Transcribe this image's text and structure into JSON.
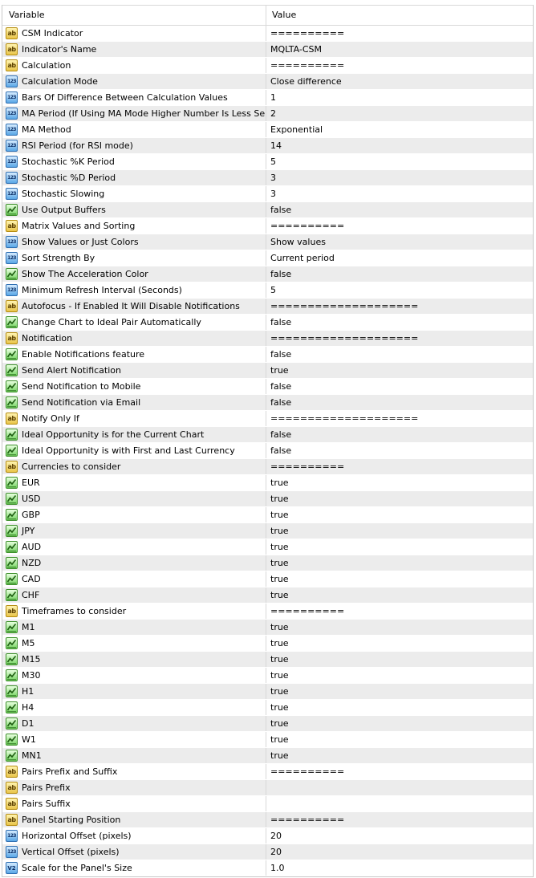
{
  "header": {
    "variable": "Variable",
    "value": "Value"
  },
  "icon_glyphs": {
    "ab": "ab",
    "num": "123",
    "dbl": "V2"
  },
  "rows": [
    {
      "icon": "ab",
      "name": "CSM Indicator",
      "value": "=========="
    },
    {
      "icon": "ab",
      "name": "Indicator's Name",
      "value": "MQLTA-CSM"
    },
    {
      "icon": "ab",
      "name": "Calculation",
      "value": "=========="
    },
    {
      "icon": "num",
      "name": "Calculation Mode",
      "value": "Close difference"
    },
    {
      "icon": "num",
      "name": "Bars Of Difference Between Calculation Values",
      "value": "1"
    },
    {
      "icon": "num",
      "name": "MA Period (If Using MA Mode Higher Number Is Less Sensitive)",
      "value": "2"
    },
    {
      "icon": "num",
      "name": "MA Method",
      "value": "Exponential"
    },
    {
      "icon": "num",
      "name": "RSI Period (for RSI mode)",
      "value": "14"
    },
    {
      "icon": "num",
      "name": "Stochastic %K Period",
      "value": "5"
    },
    {
      "icon": "num",
      "name": "Stochastic %D Period",
      "value": "3"
    },
    {
      "icon": "num",
      "name": "Stochastic Slowing",
      "value": "3"
    },
    {
      "icon": "bool",
      "name": "Use Output Buffers",
      "value": "false"
    },
    {
      "icon": "ab",
      "name": "Matrix Values and Sorting",
      "value": "=========="
    },
    {
      "icon": "num",
      "name": "Show Values or Just Colors",
      "value": "Show values"
    },
    {
      "icon": "num",
      "name": "Sort Strength By",
      "value": "Current period"
    },
    {
      "icon": "bool",
      "name": "Show The Acceleration Color",
      "value": "false"
    },
    {
      "icon": "num",
      "name": "Minimum Refresh Interval (Seconds)",
      "value": "5"
    },
    {
      "icon": "ab",
      "name": "Autofocus - If Enabled It Will Disable Notifications",
      "value": "===================="
    },
    {
      "icon": "bool",
      "name": "Change Chart to Ideal Pair Automatically",
      "value": "false"
    },
    {
      "icon": "ab",
      "name": "Notification",
      "value": "===================="
    },
    {
      "icon": "bool",
      "name": "Enable Notifications feature",
      "value": "false"
    },
    {
      "icon": "bool",
      "name": "Send Alert Notification",
      "value": "true"
    },
    {
      "icon": "bool",
      "name": "Send Notification to Mobile",
      "value": "false"
    },
    {
      "icon": "bool",
      "name": "Send Notification via Email",
      "value": "false"
    },
    {
      "icon": "ab",
      "name": "Notify Only If",
      "value": "===================="
    },
    {
      "icon": "bool",
      "name": "Ideal Opportunity is for the Current Chart",
      "value": "false"
    },
    {
      "icon": "bool",
      "name": "Ideal Opportunity is with First and Last Currency",
      "value": "false"
    },
    {
      "icon": "ab",
      "name": "Currencies to consider",
      "value": "=========="
    },
    {
      "icon": "bool",
      "name": "EUR",
      "value": "true"
    },
    {
      "icon": "bool",
      "name": "USD",
      "value": "true"
    },
    {
      "icon": "bool",
      "name": "GBP",
      "value": "true"
    },
    {
      "icon": "bool",
      "name": "JPY",
      "value": "true"
    },
    {
      "icon": "bool",
      "name": "AUD",
      "value": "true"
    },
    {
      "icon": "bool",
      "name": "NZD",
      "value": "true"
    },
    {
      "icon": "bool",
      "name": "CAD",
      "value": "true"
    },
    {
      "icon": "bool",
      "name": "CHF",
      "value": "true"
    },
    {
      "icon": "ab",
      "name": "Timeframes to consider",
      "value": "=========="
    },
    {
      "icon": "bool",
      "name": "M1",
      "value": "true"
    },
    {
      "icon": "bool",
      "name": "M5",
      "value": "true"
    },
    {
      "icon": "bool",
      "name": "M15",
      "value": "true"
    },
    {
      "icon": "bool",
      "name": "M30",
      "value": "true"
    },
    {
      "icon": "bool",
      "name": "H1",
      "value": "true"
    },
    {
      "icon": "bool",
      "name": "H4",
      "value": "true"
    },
    {
      "icon": "bool",
      "name": "D1",
      "value": "true"
    },
    {
      "icon": "bool",
      "name": "W1",
      "value": "true"
    },
    {
      "icon": "bool",
      "name": "MN1",
      "value": "true"
    },
    {
      "icon": "ab",
      "name": "Pairs Prefix and Suffix",
      "value": "=========="
    },
    {
      "icon": "ab",
      "name": "Pairs Prefix",
      "value": ""
    },
    {
      "icon": "ab",
      "name": "Pairs Suffix",
      "value": ""
    },
    {
      "icon": "ab",
      "name": "Panel Starting Position",
      "value": "=========="
    },
    {
      "icon": "num",
      "name": "Horizontal Offset (pixels)",
      "value": "20"
    },
    {
      "icon": "num",
      "name": "Vertical Offset (pixels)",
      "value": "20"
    },
    {
      "icon": "dbl",
      "name": "Scale for the Panel's Size",
      "value": "1.0"
    }
  ]
}
